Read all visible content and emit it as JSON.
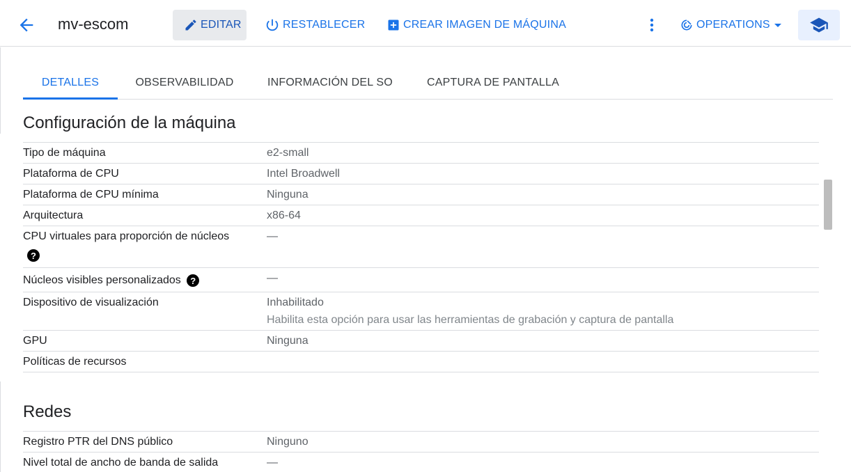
{
  "header": {
    "title": "mv-escom",
    "edit_label": "EDITAR",
    "reset_label": "RESTABLECER",
    "create_image_label": "CREAR IMAGEN DE MÁQUINA",
    "operations_label": "OPERATIONS"
  },
  "tabs": [
    {
      "label": "DETALLES",
      "active": true
    },
    {
      "label": "OBSERVABILIDAD",
      "active": false
    },
    {
      "label": "INFORMACIÓN DEL SO",
      "active": false
    },
    {
      "label": "CAPTURA DE PANTALLA",
      "active": false
    }
  ],
  "machine_config": {
    "title": "Configuración de la máquina",
    "rows": [
      {
        "label": "Tipo de máquina",
        "value": "e2-small"
      },
      {
        "label": "Plataforma de CPU",
        "value": "Intel Broadwell"
      },
      {
        "label": "Plataforma de CPU mínima",
        "value": "Ninguna"
      },
      {
        "label": "Arquitectura",
        "value": "x86-64"
      },
      {
        "label": "CPU virtuales para proporción de núcleos",
        "value": "—"
      },
      {
        "label": "Núcleos visibles personalizados",
        "value": "—"
      },
      {
        "label": "Dispositivo de visualización",
        "value": "Inhabilitado",
        "sub": "Habilita esta opción para usar las herramientas de grabación y captura de pantalla"
      },
      {
        "label": "GPU",
        "value": "Ninguna"
      },
      {
        "label": "Políticas de recursos",
        "value": ""
      }
    ]
  },
  "networking": {
    "title": "Redes",
    "rows": [
      {
        "label": "Registro PTR del DNS público",
        "value": "Ninguno"
      },
      {
        "label": "Nivel total de ancho de banda de salida",
        "value": "—"
      }
    ]
  },
  "colors": {
    "accent": "#1a73e8",
    "divider": "#dadce0"
  }
}
